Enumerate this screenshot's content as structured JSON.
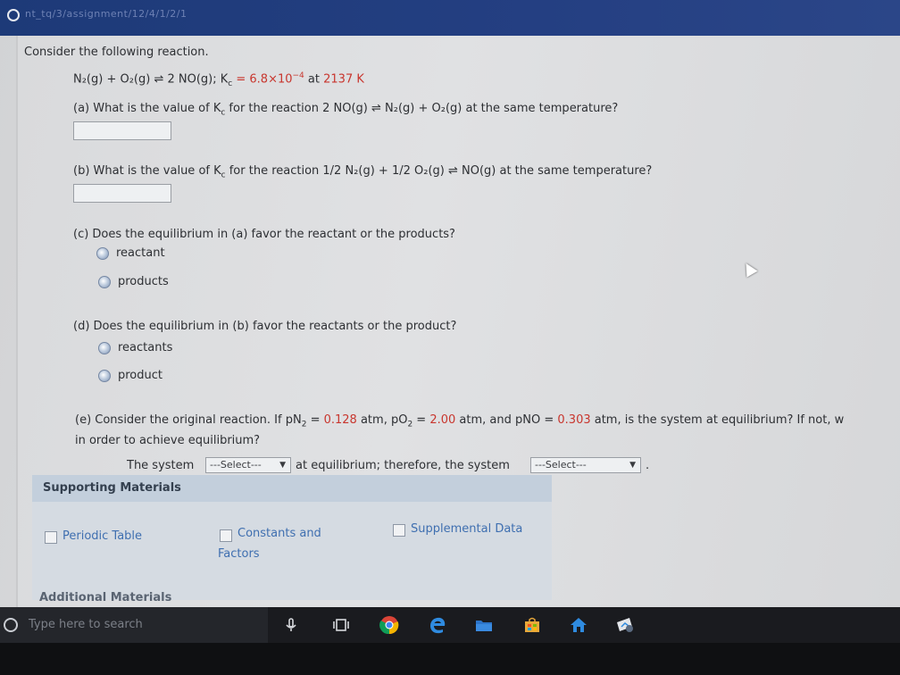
{
  "browser": {
    "crumb": "nt_tq/3/assignment/12/4/1/2/1"
  },
  "question": {
    "intro": "Consider the following reaction.",
    "reaction": "N₂(g) + O₂(g) ⇌ 2 NO(g); K",
    "kc_sub": "c",
    "kc_eq": " = 6.8×10",
    "kc_exp": "−4",
    "at_label": " at ",
    "temperature": "2137 K",
    "a_prompt": "(a) What is the value of K",
    "a_rest": " for the reaction 2 NO(g) ⇌ N₂(g) + O₂(g) at the same temperature?",
    "a_value": "",
    "b_prompt": "(b) What is the value of K",
    "b_rest": " for the reaction 1/2 N₂(g) + 1/2 O₂(g) ⇌ NO(g) at the same temperature?",
    "b_value": "",
    "c_prompt": "(c) Does the equilibrium in (a) favor the reactant or the products?",
    "c_opt1": "reactant",
    "c_opt2": "products",
    "d_prompt": "(d) Does the equilibrium in (b) favor the reactants or the product?",
    "d_opt1": "reactants",
    "d_opt2": "product",
    "e_part1": "(e) Consider the original reaction. If pN",
    "e_part2": " = ",
    "pN2": "0.128",
    "e_part3": " atm, pO",
    "e_part4": " = ",
    "pO2": "2.00",
    "e_part5": " atm, and pNO = ",
    "pNO": "0.303",
    "e_part6": " atm, is the system at equilibrium? If not, w",
    "e_line2": "in order to achieve equilibrium?",
    "system_label": "The system",
    "select1": "---Select---",
    "mid_label": "at equilibrium; therefore, the system",
    "select2": "---Select---",
    "end_dot": "."
  },
  "support": {
    "title": "Supporting Materials",
    "periodic": "Periodic Table",
    "constants1": "Constants and",
    "constants2": "Factors",
    "supplemental": "Supplemental Data",
    "additional": "Additional Materials"
  },
  "taskbar": {
    "search_placeholder": "Type here to search"
  },
  "colors": {
    "given_value": "#c8362e",
    "link": "#3f6fb0",
    "header": "#1d3a78"
  }
}
